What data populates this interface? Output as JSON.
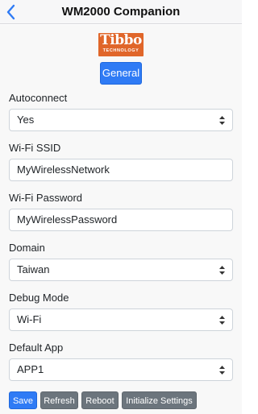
{
  "header": {
    "title": "WM2000 Companion"
  },
  "logo": {
    "main": "Tibbo",
    "sub": "TECHNOLOGY",
    "color": "#e0662a"
  },
  "tabs": {
    "general": "General"
  },
  "form": {
    "autoconnect": {
      "label": "Autoconnect",
      "value": "Yes"
    },
    "wifi_ssid": {
      "label": "Wi-Fi SSID",
      "value": "MyWirelessNetwork"
    },
    "wifi_password": {
      "label": "Wi-Fi Password",
      "value": "MyWirelessPassword"
    },
    "domain": {
      "label": "Domain",
      "value": "Taiwan"
    },
    "debug_mode": {
      "label": "Debug Mode",
      "value": "Wi-Fi"
    },
    "default_app": {
      "label": "Default App",
      "value": "APP1"
    }
  },
  "actions": {
    "save": "Save",
    "refresh": "Refresh",
    "reboot": "Reboot",
    "initialize": "Initialize Settings"
  },
  "colors": {
    "primary": "#2f7bf5",
    "secondary": "#6c757d",
    "ios_blue": "#2f7bf5"
  },
  "icons": {
    "back": "chevron-left-icon",
    "select": "select-caret-icon"
  }
}
